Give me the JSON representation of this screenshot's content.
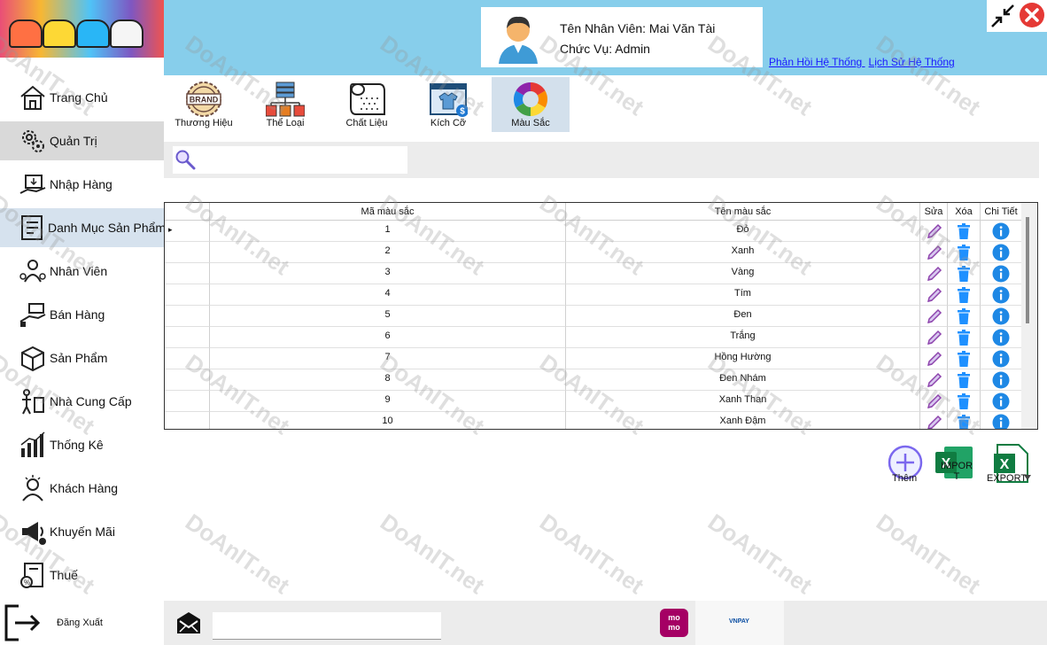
{
  "header": {
    "user_name": "Tên Nhân Viên: Mai Văn Tài",
    "user_role": "Chức Vụ: Admin",
    "link_feedback": "Phản Hồi Hệ Thống",
    "link_history": "Lịch Sử Hệ Thống"
  },
  "sidebar": {
    "items": [
      {
        "label": "Trang Chủ",
        "icon": "home-icon"
      },
      {
        "label": "Quản Trị",
        "icon": "gears-icon"
      },
      {
        "label": "Nhập Hàng",
        "icon": "import-box-icon"
      },
      {
        "label": "Danh Mục Sản Phẩm",
        "icon": "catalog-icon"
      },
      {
        "label": "Nhân Viên",
        "icon": "staff-icon"
      },
      {
        "label": "Bán Hàng",
        "icon": "sale-icon"
      },
      {
        "label": "Sản Phẩm",
        "icon": "product-box-icon"
      },
      {
        "label": "Nhà Cung Cấp",
        "icon": "supplier-icon"
      },
      {
        "label": "Thống Kê",
        "icon": "chart-icon"
      },
      {
        "label": "Khách Hàng",
        "icon": "customer-icon"
      },
      {
        "label": "Khuyến Mãi",
        "icon": "megaphone-icon"
      },
      {
        "label": "Thuế",
        "icon": "tax-icon"
      }
    ],
    "logout": "Đăng Xuất"
  },
  "categories": [
    {
      "label": "Thương Hiệu",
      "badge": "BRAND"
    },
    {
      "label": "Thể Loại"
    },
    {
      "label": "Chất Liệu"
    },
    {
      "label": "Kích Cỡ",
      "badge": "$"
    },
    {
      "label": "Màu Sắc"
    }
  ],
  "grid": {
    "headers": {
      "code": "Mã màu sắc",
      "name": "Tên màu sắc",
      "edit": "Sửa",
      "delete": "Xóa",
      "detail": "Chi Tiết"
    },
    "rows": [
      {
        "code": "1",
        "name": "Đỏ"
      },
      {
        "code": "2",
        "name": "Xanh"
      },
      {
        "code": "3",
        "name": "Vàng"
      },
      {
        "code": "4",
        "name": "Tím"
      },
      {
        "code": "5",
        "name": "Đen"
      },
      {
        "code": "6",
        "name": "Trắng"
      },
      {
        "code": "7",
        "name": "Hồng Hường"
      },
      {
        "code": "8",
        "name": "Đen Nhám"
      },
      {
        "code": "9",
        "name": "Xanh Than"
      },
      {
        "code": "10",
        "name": "Xanh Đậm"
      }
    ],
    "row_pointer": "▸"
  },
  "actions": {
    "add": "Thêm",
    "import": "IMPOR T",
    "export": "EXPORT",
    "excel_glyph": "X"
  },
  "footer": {
    "momo_line1": "mo",
    "momo_line2": "mo",
    "vnpay": "VNPAY"
  },
  "watermark": "DoAnIT.net",
  "colors": {
    "header_bg": "#87ceeb",
    "link": "#1a1aff",
    "edit_icon": "#8e44ad",
    "delete_icon": "#1e90ff",
    "detail_icon": "#1e88e5",
    "close_btn": "#e53935",
    "momo": "#a50064"
  }
}
